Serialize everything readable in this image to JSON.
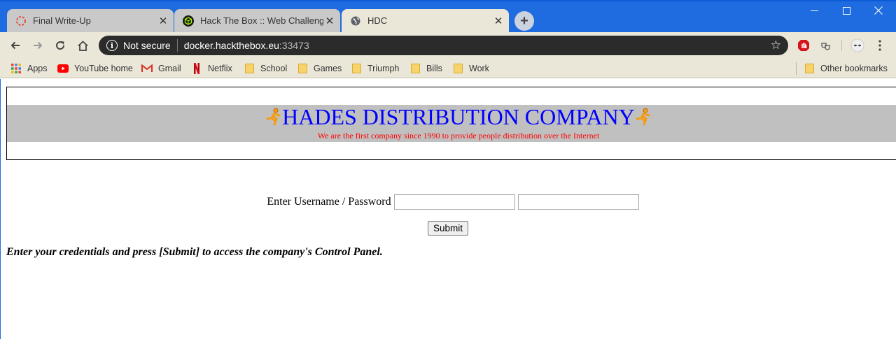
{
  "browser": {
    "tabs": [
      {
        "title": "Final Write-Up",
        "icon": "circle-dashed-icon",
        "active": false
      },
      {
        "title": "Hack The Box :: Web Challenges",
        "icon": "htb-cube-icon",
        "active": false
      },
      {
        "title": "HDC",
        "icon": "globe-icon",
        "active": true
      }
    ],
    "address": {
      "security_label": "Not secure",
      "host": "docker.hackthebox.eu",
      "port": ":33473"
    },
    "bookmarks": [
      {
        "label": "Apps",
        "icon": "apps-grid-icon"
      },
      {
        "label": "YouTube home",
        "icon": "youtube-icon"
      },
      {
        "label": "Gmail",
        "icon": "gmail-icon"
      },
      {
        "label": "Netflix",
        "icon": "netflix-icon"
      },
      {
        "label": "School",
        "icon": "folder-icon"
      },
      {
        "label": "Games",
        "icon": "folder-icon"
      },
      {
        "label": "Triumph",
        "icon": "folder-icon"
      },
      {
        "label": "Bills",
        "icon": "folder-icon"
      },
      {
        "label": "Work",
        "icon": "folder-icon"
      }
    ],
    "other_bookmarks": "Other bookmarks"
  },
  "page": {
    "title": "HADES DISTRIBUTION COMPANY",
    "subtitle": "We are the first company since 1990 to provide people distribution over the Internet",
    "login_label": "Enter Username / Password",
    "username_value": "",
    "password_value": "",
    "submit_label": "Submit",
    "instructions": "Enter your credentials and press [Submit] to access the company's Control Panel."
  },
  "colors": {
    "titlebar": "#1e6ce0",
    "toolbar": "#eae6d8",
    "header_band": "#c0c0c0",
    "title_text": "#0000ff",
    "subtitle_text": "#ff0000"
  }
}
